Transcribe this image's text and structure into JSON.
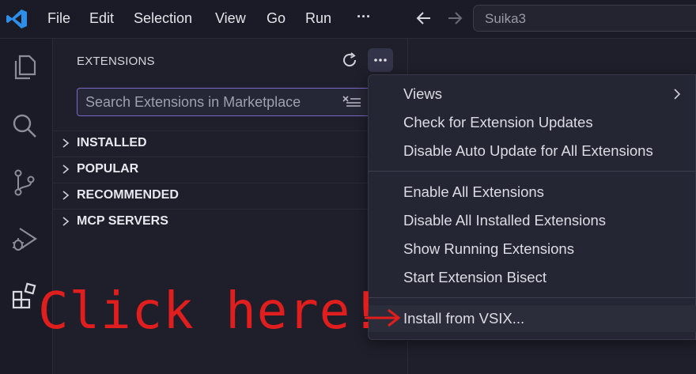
{
  "titlebar": {
    "menu": [
      "File",
      "Edit",
      "Selection",
      "View",
      "Go",
      "Run"
    ],
    "more": "···",
    "command_center": "Suika3"
  },
  "activity_bar": {
    "icons": [
      "explorer-icon",
      "search-icon",
      "source-control-icon",
      "run-debug-icon",
      "extensions-icon"
    ]
  },
  "sidebar": {
    "title": "EXTENSIONS",
    "search": {
      "placeholder": "Search Extensions in Marketplace",
      "value": ""
    },
    "sections": [
      "INSTALLED",
      "POPULAR",
      "RECOMMENDED",
      "MCP SERVERS"
    ]
  },
  "menu": {
    "group1": [
      "Views",
      "Check for Extension Updates",
      "Disable Auto Update for All Extensions"
    ],
    "group2": [
      "Enable All Extensions",
      "Disable All Installed Extensions",
      "Show Running Extensions",
      "Start Extension Bisect"
    ],
    "group3": [
      "Install from VSIX..."
    ]
  },
  "annotation": {
    "text": "Click here!",
    "color": "#e01e1e"
  },
  "colors": {
    "accent": "#7b68c9",
    "background": "#1e1f2b"
  }
}
